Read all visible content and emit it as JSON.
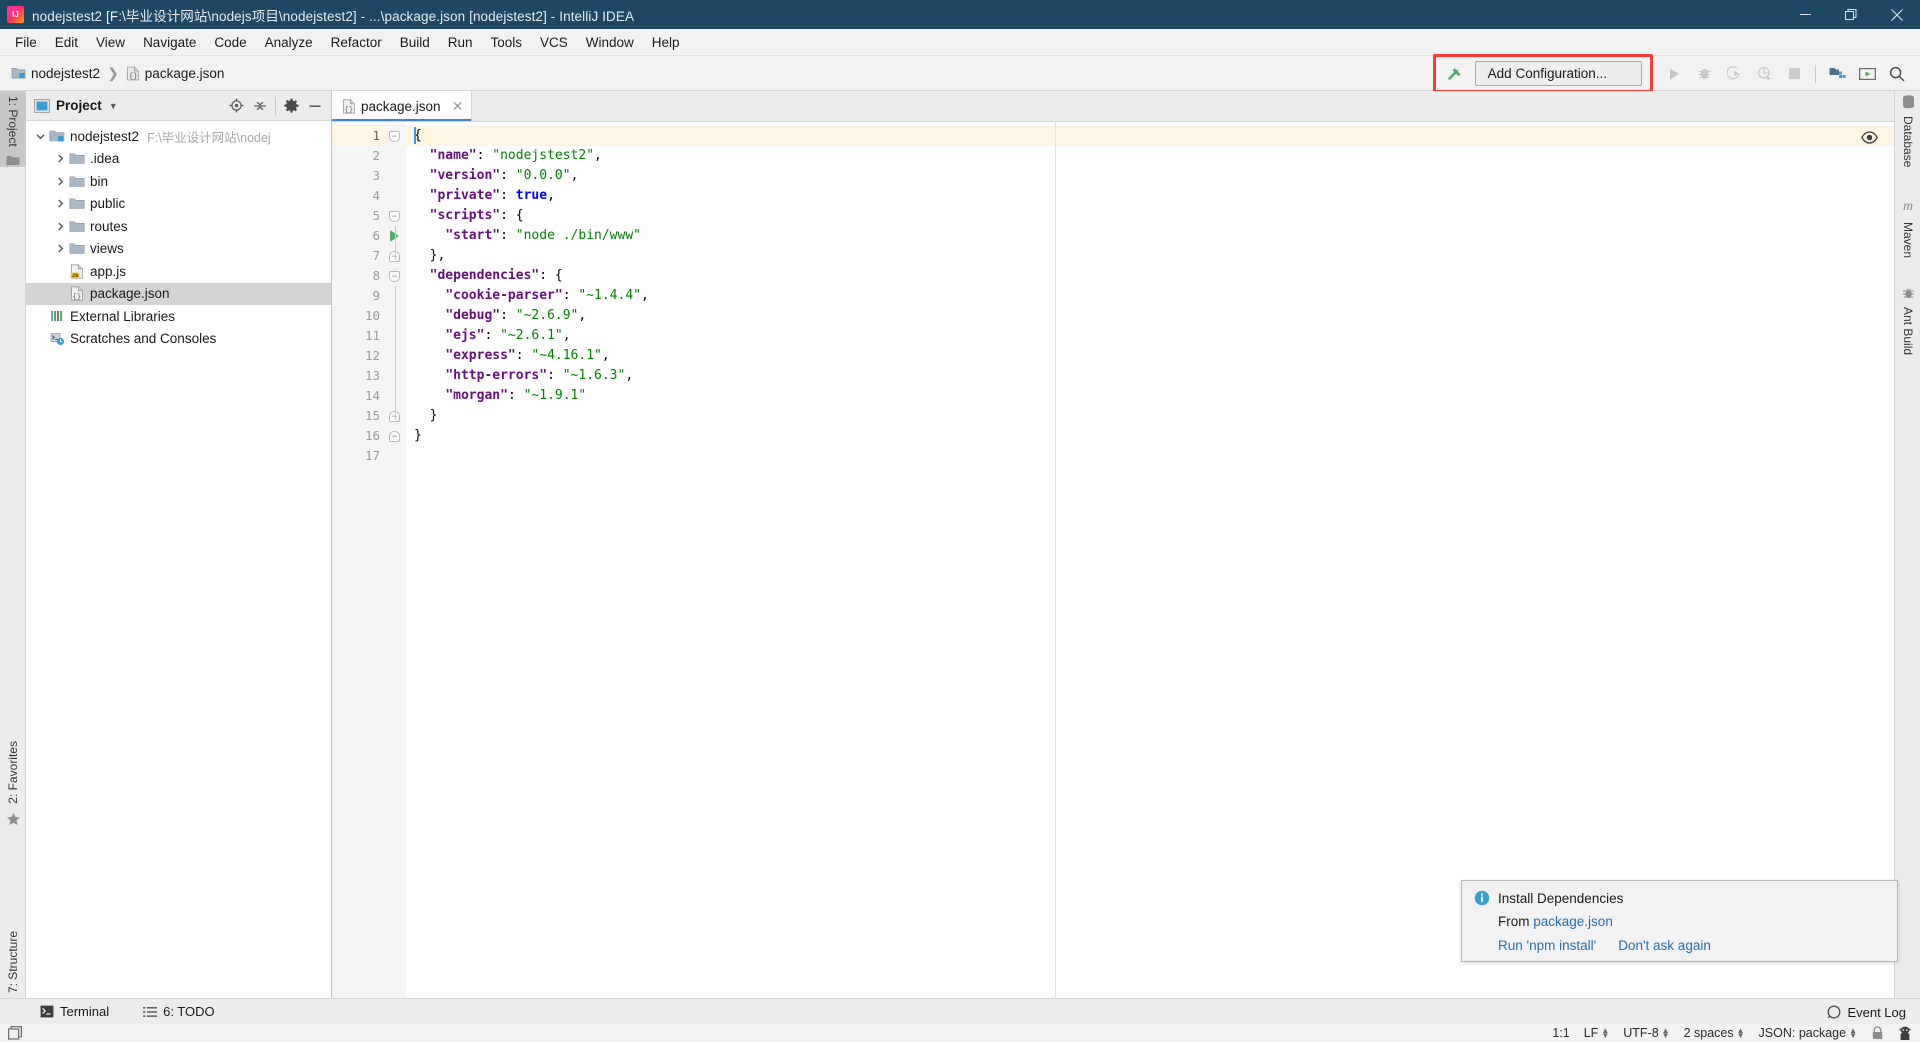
{
  "window": {
    "title": "nodejstest2 [F:\\毕业设计网站\\nodejs项目\\nodejstest2] - ...\\package.json [nodejstest2] - IntelliJ IDEA",
    "minimize_label": "Minimize",
    "maximize_label": "Restore",
    "close_label": "Close"
  },
  "menu": {
    "items": [
      {
        "label": "File"
      },
      {
        "label": "Edit"
      },
      {
        "label": "View"
      },
      {
        "label": "Navigate"
      },
      {
        "label": "Code"
      },
      {
        "label": "Analyze"
      },
      {
        "label": "Refactor"
      },
      {
        "label": "Build"
      },
      {
        "label": "Run"
      },
      {
        "label": "Tools"
      },
      {
        "label": "VCS"
      },
      {
        "label": "Window"
      },
      {
        "label": "Help"
      }
    ]
  },
  "navbar": {
    "breadcrumbs": [
      {
        "label": "nodejstest2",
        "icon": "module-folder-icon"
      },
      {
        "label": "package.json",
        "icon": "json-file-icon"
      }
    ],
    "separator": "❯",
    "add_configuration_label": "Add Configuration...",
    "build_icon": "hammer-icon",
    "highlight_color": "#fc3a34",
    "toolbar_icons": [
      {
        "name": "run-icon",
        "label": "Run"
      },
      {
        "name": "debug-icon",
        "label": "Debug"
      },
      {
        "name": "run-with-coverage-icon",
        "label": "Run with Coverage"
      },
      {
        "name": "profiler-icon",
        "label": "Profile"
      },
      {
        "name": "stop-icon",
        "label": "Stop"
      },
      {
        "name": "project-structure-icon",
        "label": "Project Structure"
      },
      {
        "name": "presentation-icon",
        "label": "Presentation Mode"
      },
      {
        "name": "search-everywhere-icon",
        "label": "Search Everywhere"
      }
    ]
  },
  "left_strip": {
    "top_tabs": [
      {
        "label": "1: Project",
        "icon": "project-folder-icon",
        "active": true
      }
    ],
    "bottom_tabs": [
      {
        "label": "2: Favorites",
        "icon": "star-icon",
        "active": false
      },
      {
        "label": "7: Structure",
        "icon": "structure-icon",
        "active": false
      }
    ]
  },
  "right_strip": {
    "tabs": [
      {
        "label": "Database",
        "icon": "database-icon"
      },
      {
        "label": "Maven",
        "icon": "maven-icon"
      },
      {
        "label": "Ant Build",
        "icon": "ant-icon"
      }
    ]
  },
  "project_panel": {
    "title": "Project",
    "caret": "▼",
    "tools": [
      {
        "name": "locate-icon",
        "label": "Select Opened File"
      },
      {
        "name": "collapse-all-icon",
        "label": "Collapse All"
      },
      {
        "name": "settings-gear-icon",
        "label": "Settings"
      },
      {
        "name": "hide-icon",
        "label": "Hide"
      }
    ],
    "tree": [
      {
        "label": "nodejstest2",
        "sub": "F:\\毕业设计网站\\nodej",
        "icon": "module-folder-icon",
        "indent": 0,
        "arrow": "expanded",
        "selected": false
      },
      {
        "label": ".idea",
        "sub": "",
        "icon": "folder-icon",
        "indent": 1,
        "arrow": "collapsed",
        "selected": false
      },
      {
        "label": "bin",
        "sub": "",
        "icon": "folder-icon",
        "indent": 1,
        "arrow": "collapsed",
        "selected": false
      },
      {
        "label": "public",
        "sub": "",
        "icon": "folder-icon",
        "indent": 1,
        "arrow": "collapsed",
        "selected": false
      },
      {
        "label": "routes",
        "sub": "",
        "icon": "folder-icon",
        "indent": 1,
        "arrow": "collapsed",
        "selected": false
      },
      {
        "label": "views",
        "sub": "",
        "icon": "folder-icon",
        "indent": 1,
        "arrow": "collapsed",
        "selected": false
      },
      {
        "label": "app.js",
        "sub": "",
        "icon": "js-file-icon",
        "indent": 1,
        "arrow": "none",
        "selected": false
      },
      {
        "label": "package.json",
        "sub": "",
        "icon": "json-file-icon",
        "indent": 1,
        "arrow": "none",
        "selected": true
      },
      {
        "label": "External Libraries",
        "sub": "",
        "icon": "libraries-icon",
        "indent": 0,
        "arrow": "none",
        "selected": false
      },
      {
        "label": "Scratches and Consoles",
        "sub": "",
        "icon": "scratches-icon",
        "indent": 0,
        "arrow": "none",
        "selected": false
      }
    ]
  },
  "editor": {
    "tabs": [
      {
        "label": "package.json",
        "icon": "json-file-icon",
        "active": true,
        "close": "✕"
      }
    ],
    "eye_icon": "eye-icon",
    "caret_line": 1,
    "run_gutter_line": 6,
    "lines": [
      {
        "n": "1",
        "fold": "expanded",
        "tokens": [
          {
            "t": "{",
            "c": "brace"
          }
        ]
      },
      {
        "n": "2",
        "fold": "",
        "tokens": [
          {
            "t": "  ",
            "c": "punc"
          },
          {
            "t": "\"name\"",
            "c": "key"
          },
          {
            "t": ": ",
            "c": "punc"
          },
          {
            "t": "\"nodejstest2\"",
            "c": "str"
          },
          {
            "t": ",",
            "c": "punc"
          }
        ]
      },
      {
        "n": "3",
        "fold": "",
        "tokens": [
          {
            "t": "  ",
            "c": "punc"
          },
          {
            "t": "\"version\"",
            "c": "key"
          },
          {
            "t": ": ",
            "c": "punc"
          },
          {
            "t": "\"0.0.0\"",
            "c": "str"
          },
          {
            "t": ",",
            "c": "punc"
          }
        ]
      },
      {
        "n": "4",
        "fold": "",
        "tokens": [
          {
            "t": "  ",
            "c": "punc"
          },
          {
            "t": "\"private\"",
            "c": "key"
          },
          {
            "t": ": ",
            "c": "punc"
          },
          {
            "t": "true",
            "c": "bool"
          },
          {
            "t": ",",
            "c": "punc"
          }
        ]
      },
      {
        "n": "5",
        "fold": "expanded",
        "tokens": [
          {
            "t": "  ",
            "c": "punc"
          },
          {
            "t": "\"scripts\"",
            "c": "key"
          },
          {
            "t": ": {",
            "c": "brace"
          }
        ]
      },
      {
        "n": "6",
        "fold": "",
        "tokens": [
          {
            "t": "    ",
            "c": "punc"
          },
          {
            "t": "\"start\"",
            "c": "key"
          },
          {
            "t": ": ",
            "c": "punc"
          },
          {
            "t": "\"node ./bin/www\"",
            "c": "str"
          }
        ]
      },
      {
        "n": "7",
        "fold": "end",
        "tokens": [
          {
            "t": "  },",
            "c": "brace"
          }
        ]
      },
      {
        "n": "8",
        "fold": "expanded",
        "tokens": [
          {
            "t": "  ",
            "c": "punc"
          },
          {
            "t": "\"dependencies\"",
            "c": "key"
          },
          {
            "t": ": {",
            "c": "brace"
          }
        ]
      },
      {
        "n": "9",
        "fold": "",
        "tokens": [
          {
            "t": "    ",
            "c": "punc"
          },
          {
            "t": "\"cookie-parser\"",
            "c": "key"
          },
          {
            "t": ": ",
            "c": "punc"
          },
          {
            "t": "\"~1.4.4\"",
            "c": "str"
          },
          {
            "t": ",",
            "c": "punc"
          }
        ]
      },
      {
        "n": "10",
        "fold": "",
        "tokens": [
          {
            "t": "    ",
            "c": "punc"
          },
          {
            "t": "\"debug\"",
            "c": "key"
          },
          {
            "t": ": ",
            "c": "punc"
          },
          {
            "t": "\"~2.6.9\"",
            "c": "str"
          },
          {
            "t": ",",
            "c": "punc"
          }
        ]
      },
      {
        "n": "11",
        "fold": "",
        "tokens": [
          {
            "t": "    ",
            "c": "punc"
          },
          {
            "t": "\"ejs\"",
            "c": "key"
          },
          {
            "t": ": ",
            "c": "punc"
          },
          {
            "t": "\"~2.6.1\"",
            "c": "str"
          },
          {
            "t": ",",
            "c": "punc"
          }
        ]
      },
      {
        "n": "12",
        "fold": "",
        "tokens": [
          {
            "t": "    ",
            "c": "punc"
          },
          {
            "t": "\"express\"",
            "c": "key"
          },
          {
            "t": ": ",
            "c": "punc"
          },
          {
            "t": "\"~4.16.1\"",
            "c": "str"
          },
          {
            "t": ",",
            "c": "punc"
          }
        ]
      },
      {
        "n": "13",
        "fold": "",
        "tokens": [
          {
            "t": "    ",
            "c": "punc"
          },
          {
            "t": "\"http-errors\"",
            "c": "key"
          },
          {
            "t": ": ",
            "c": "punc"
          },
          {
            "t": "\"~1.6.3\"",
            "c": "str"
          },
          {
            "t": ",",
            "c": "punc"
          }
        ]
      },
      {
        "n": "14",
        "fold": "",
        "tokens": [
          {
            "t": "    ",
            "c": "punc"
          },
          {
            "t": "\"morgan\"",
            "c": "key"
          },
          {
            "t": ": ",
            "c": "punc"
          },
          {
            "t": "\"~1.9.1\"",
            "c": "str"
          }
        ]
      },
      {
        "n": "15",
        "fold": "end",
        "tokens": [
          {
            "t": "  }",
            "c": "brace"
          }
        ]
      },
      {
        "n": "16",
        "fold": "end",
        "tokens": [
          {
            "t": "}",
            "c": "brace"
          }
        ]
      },
      {
        "n": "17",
        "fold": "",
        "tokens": []
      }
    ]
  },
  "notification": {
    "icon": "info-icon",
    "title": "Install Dependencies",
    "from_label": "From",
    "from_file": "package.json",
    "action_run": "Run 'npm install'",
    "action_dismiss": "Don't ask again"
  },
  "bottom_bar": {
    "items": [
      {
        "label": "Terminal",
        "icon": "terminal-icon"
      },
      {
        "label": "6: TODO",
        "icon": "todo-icon"
      }
    ],
    "event_log": {
      "label": "Event Log",
      "icon": "event-log-icon"
    }
  },
  "status_bar": {
    "position": "1:1",
    "line_separator": "LF",
    "encoding": "UTF-8",
    "indent": "2 spaces",
    "file_type": "JSON: package",
    "lock_icon": "lock-icon",
    "inspector_icon": "inspector-icon"
  }
}
